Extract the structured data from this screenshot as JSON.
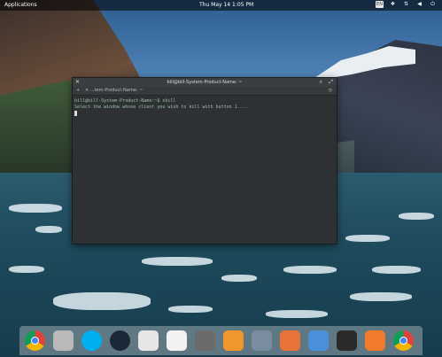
{
  "panel": {
    "applications_label": "Applications",
    "datetime": "Thu May 14  1:05 PM",
    "tray_icons": [
      "keyboard-icon",
      "dropbox-icon",
      "network-icon",
      "volume-icon",
      "power-icon"
    ],
    "keyboard_label": "EN"
  },
  "terminal": {
    "title": "bill@bill-System-Product-Name: ~",
    "tab_label": "...tem-Product-Name: ~",
    "prompt": "bill@bill-System-Product-Name:~$ xkill",
    "output": "Select the window whose client you wish to kill with button 1...."
  },
  "dock": {
    "apps": [
      {
        "name": "Chrome",
        "icon": "chrome-icon",
        "color": "#dd4b39"
      },
      {
        "name": "Files",
        "icon": "home-folder-icon",
        "color": "#b9b9b9"
      },
      {
        "name": "Skype",
        "icon": "skype-icon",
        "color": "#00aff0"
      },
      {
        "name": "Steam",
        "icon": "steam-icon",
        "color": "#1b2838"
      },
      {
        "name": "Calculator",
        "icon": "spreadsheet-icon",
        "color": "#e6e6e6"
      },
      {
        "name": "Image Viewer",
        "icon": "image-viewer-icon",
        "color": "#f2f2f2"
      },
      {
        "name": "System Monitor",
        "icon": "system-monitor-icon",
        "color": "#6b6b6b"
      },
      {
        "name": "Music",
        "icon": "music-icon",
        "color": "#f0962d"
      },
      {
        "name": "Screenshot",
        "icon": "screenshot-icon",
        "color": "#7a8da0"
      },
      {
        "name": "AppCenter",
        "icon": "appcenter-icon",
        "color": "#e9713a"
      },
      {
        "name": "Settings",
        "icon": "toggle-settings-icon",
        "color": "#4a90d9"
      },
      {
        "name": "Terminal",
        "icon": "terminal-icon",
        "color": "#2a2a2a"
      },
      {
        "name": "Updates",
        "icon": "update-icon",
        "color": "#ef7b2b"
      },
      {
        "name": "Chrome",
        "icon": "chrome-icon",
        "color": "#dd4b39"
      }
    ]
  }
}
